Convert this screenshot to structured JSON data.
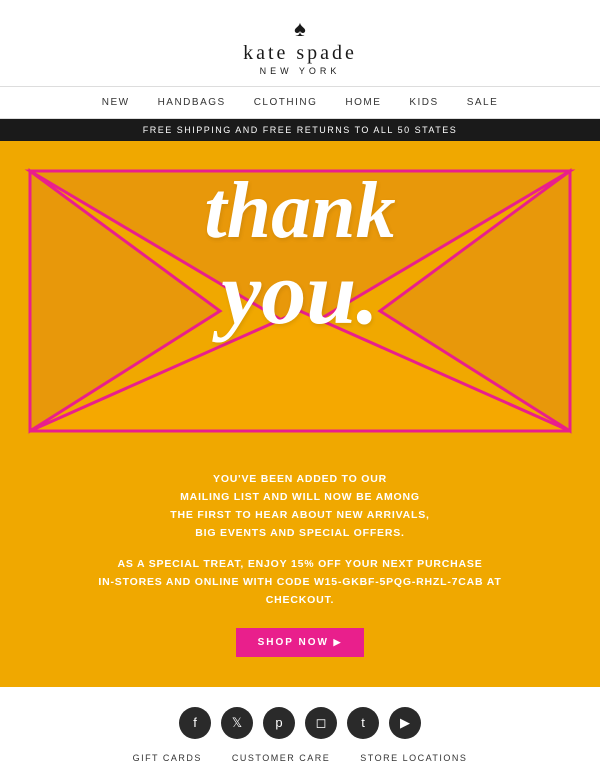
{
  "header": {
    "spade_symbol": "♠",
    "brand_name": "kate spade",
    "brand_sub": "NEW YORK"
  },
  "nav": {
    "items": [
      {
        "label": "NEW"
      },
      {
        "label": "HANDBAGS"
      },
      {
        "label": "CLOTHING"
      },
      {
        "label": "HOME"
      },
      {
        "label": "KIDS"
      },
      {
        "label": "SALE"
      }
    ]
  },
  "banner": {
    "text": "FREE SHIPPING AND FREE RETURNS TO ALL 50 STATES"
  },
  "envelope": {
    "thank_line1": "thank",
    "thank_line2": "you."
  },
  "body": {
    "paragraph1": "YOU'VE BEEN ADDED TO OUR\nMAILING LIST AND WILL NOW BE AMONG\nTHE FIRST TO HEAR ABOUT NEW ARRIVALS,\nBIG EVENTS AND SPECIAL OFFERS.",
    "paragraph2": "AS A SPECIAL TREAT, ENJOY 15% OFF YOUR NEXT PURCHASE\nIN-STORES AND ONLINE WITH CODE W15-GKBF-5PQG-RHZL-7CAB AT\nCHECKOUT.",
    "shop_now_label": "SHOP NOW"
  },
  "footer": {
    "social": [
      {
        "name": "facebook",
        "icon": "f"
      },
      {
        "name": "twitter",
        "icon": "t"
      },
      {
        "name": "pinterest",
        "icon": "p"
      },
      {
        "name": "instagram",
        "icon": "◻"
      },
      {
        "name": "tumblr",
        "icon": "T"
      },
      {
        "name": "youtube",
        "icon": "▶"
      }
    ],
    "links": [
      {
        "label": "GIFT CARDS"
      },
      {
        "label": "CUSTOMER CARE"
      },
      {
        "label": "STORE LOCATIONS"
      }
    ]
  },
  "colors": {
    "orange": "#f0a800",
    "pink": "#e91f8c",
    "dark": "#1a1a1a",
    "white": "#ffffff"
  }
}
